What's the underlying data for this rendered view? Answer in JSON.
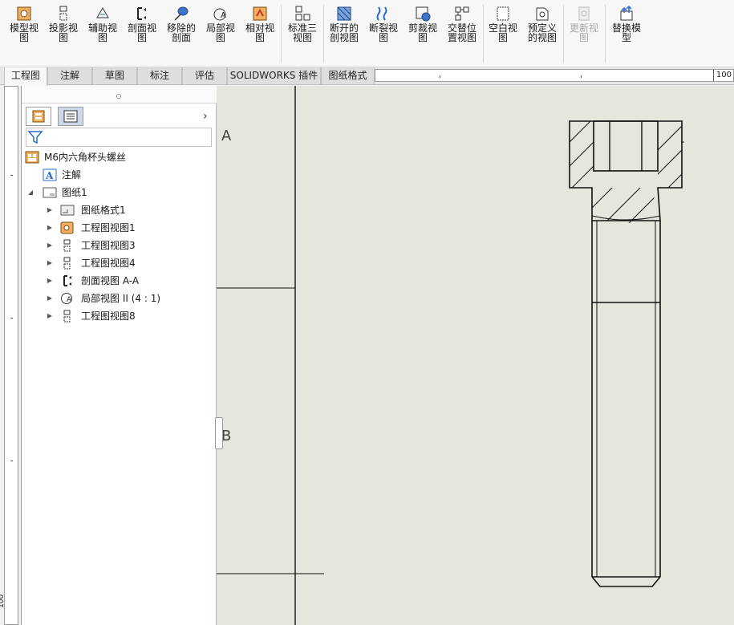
{
  "ribbon": {
    "buttons": [
      {
        "label": "模型视图",
        "icon": "model-view-icon"
      },
      {
        "label": "投影视图",
        "icon": "projected-view-icon"
      },
      {
        "label": "辅助视图",
        "icon": "auxiliary-view-icon"
      },
      {
        "label": "剖面视图",
        "icon": "section-view-icon"
      },
      {
        "label": "移除的剖面",
        "icon": "removed-section-icon"
      },
      {
        "label": "局部视图",
        "icon": "detail-view-icon"
      },
      {
        "label": "相对视图",
        "icon": "relative-view-icon"
      },
      {
        "label": "标准三视图",
        "icon": "standard-3-view-icon"
      },
      {
        "label": "断开的剖视图",
        "icon": "broken-out-section-icon"
      },
      {
        "label": "断裂视图",
        "icon": "break-view-icon"
      },
      {
        "label": "剪裁视图",
        "icon": "crop-view-icon"
      },
      {
        "label": "交替位置视图",
        "icon": "alternate-position-icon"
      },
      {
        "label": "空白视图",
        "icon": "empty-view-icon"
      },
      {
        "label": "预定义的视图",
        "icon": "predefined-view-icon"
      },
      {
        "label": "更新视图",
        "icon": "update-view-icon",
        "disabled": true
      },
      {
        "label": "替换模型",
        "icon": "replace-model-icon"
      }
    ]
  },
  "tabs": [
    {
      "label": "工程图",
      "active": true
    },
    {
      "label": "注解"
    },
    {
      "label": "草图"
    },
    {
      "label": "标注"
    },
    {
      "label": "评估"
    },
    {
      "label": "SOLIDWORKS 插件"
    },
    {
      "label": "图纸格式"
    }
  ],
  "ruler": {
    "h_value": "100",
    "v_value": "100"
  },
  "tree": {
    "root": "M6内六角杯头螺丝",
    "annotations": "注解",
    "sheet": "图纸1",
    "children": [
      "图纸格式1",
      "工程图视图1",
      "工程图视图3",
      "工程图视图4",
      "剖面视图 A-A",
      "局部视图 II (4 : 1)",
      "工程图视图8"
    ]
  },
  "sheet_labels": {
    "zone_a": "A",
    "zone_b": "B"
  },
  "colors": {
    "canvas": "#e6e6dc",
    "ribbon": "#f7f7f7",
    "selected_tab": "#cfd8e8"
  }
}
